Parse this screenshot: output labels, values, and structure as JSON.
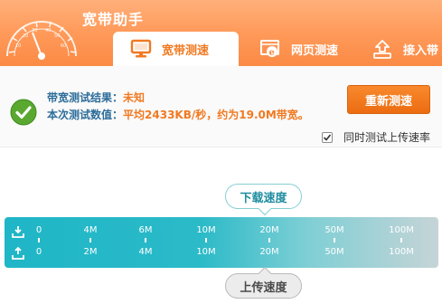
{
  "app": {
    "title": "宽带助手"
  },
  "tabs": [
    {
      "label": "宽带测速",
      "icon": "monitor-icon",
      "active": true
    },
    {
      "label": "网页测速",
      "icon": "ie-browser-icon",
      "active": false
    },
    {
      "label": "接入带",
      "icon": "upload-box-icon",
      "active": false
    }
  ],
  "result": {
    "result_label": "带宽测试结果：",
    "result_value": "未知",
    "value_label": "本次测试数值：",
    "value_text": "平均2433KB/秒，约为19.0M带宽。"
  },
  "retest_button": "重新测速",
  "upload_option": {
    "label": "同时测试上传速率",
    "checked": true
  },
  "scale": {
    "download_label": "下载速度",
    "upload_label": "上传速度",
    "download_ticks": [
      "0",
      "4M",
      "6M",
      "10M",
      "20M",
      "50M",
      "100M"
    ],
    "upload_ticks": [
      "0",
      "2M",
      "4M",
      "10M",
      "20M",
      "50M",
      "100M"
    ]
  },
  "colors": {
    "accent": "#f07a22",
    "header": "#fb8a45",
    "label_blue": "#2d6d9a",
    "scale": "#1fb6c7"
  }
}
